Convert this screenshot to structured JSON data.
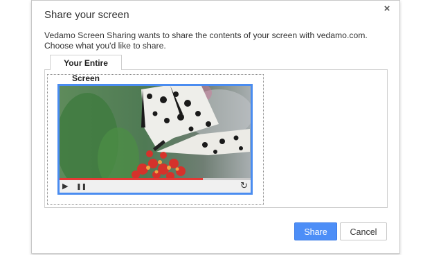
{
  "dialog": {
    "title": "Share your screen",
    "description": "Vedamo Screen Sharing wants to share the contents of your screen with vedamo.com. Choose what you'd like to share.",
    "close_symbol": "×",
    "tabs": [
      {
        "label": "Your Entire Screen",
        "selected": true
      }
    ],
    "thumbnail": {
      "icon": "butterfly-on-red-flowers-image",
      "player": {
        "play_symbol": "▶",
        "pause_symbol": "❚❚",
        "reload_symbol": "↻",
        "progress": 0.75
      }
    },
    "buttons": {
      "share": "Share",
      "cancel": "Cancel"
    },
    "colors": {
      "accent": "#4d8ef7",
      "progress": "#e53935",
      "thumb_border": "#4a8cf0"
    }
  }
}
